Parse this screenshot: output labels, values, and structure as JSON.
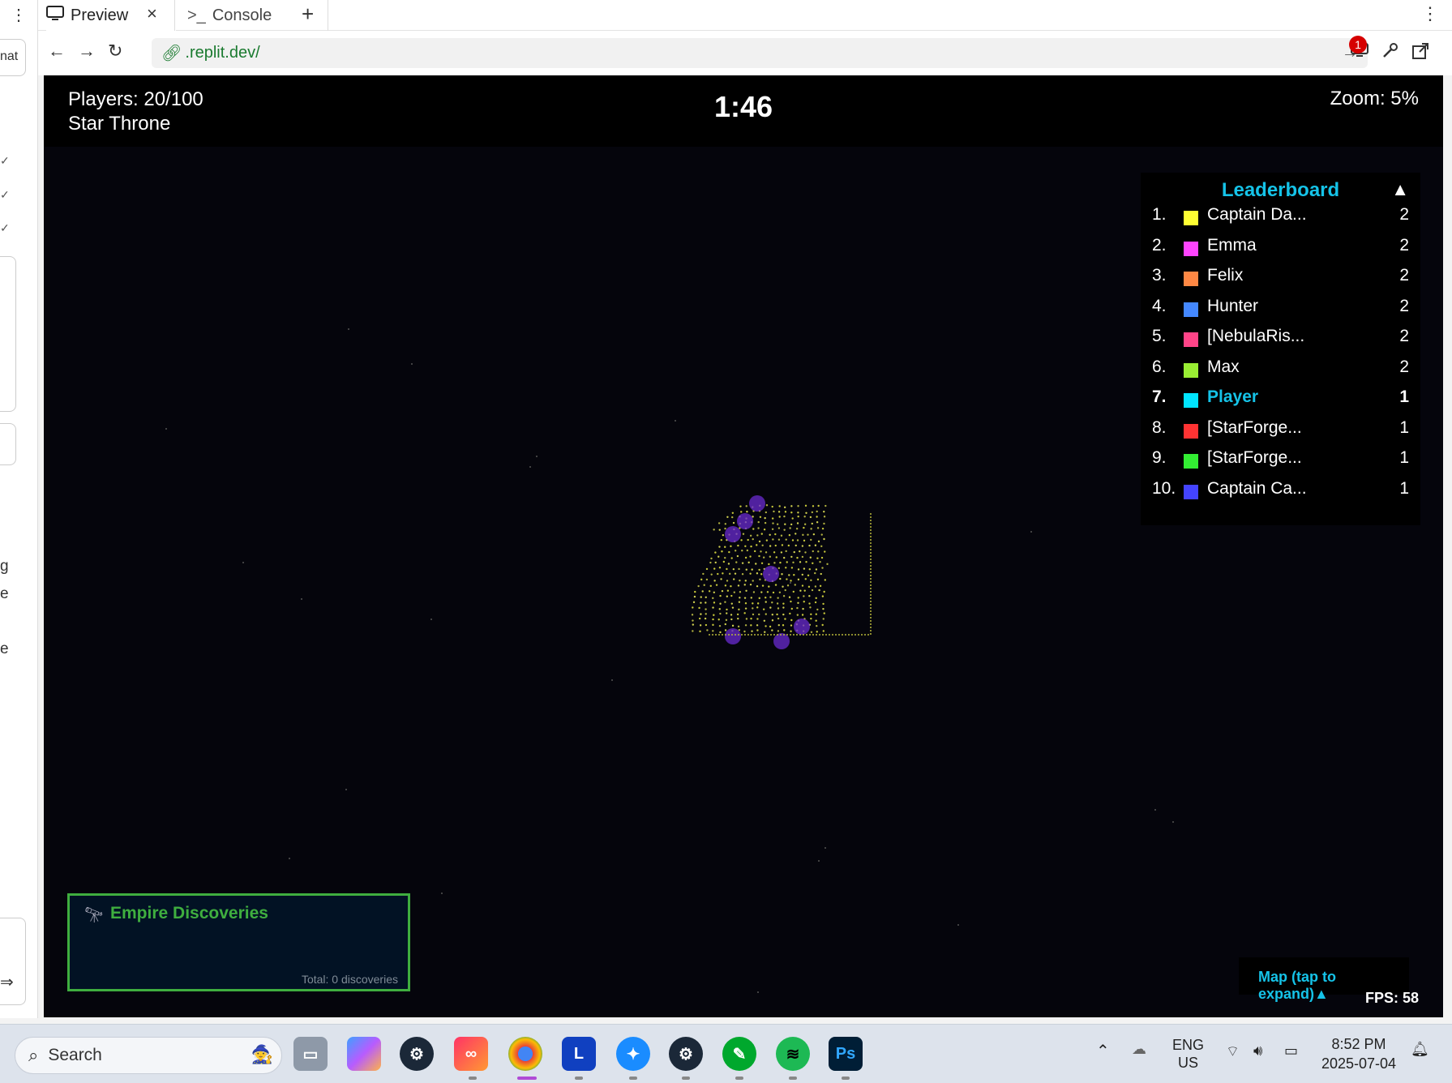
{
  "left_sidebar": {
    "fragment_top": "nat",
    "fragment_g": "g",
    "fragment_e1": "e",
    "fragment_e2": "e",
    "send_icon": "send-icon"
  },
  "browser": {
    "tabs": [
      {
        "label": "Preview",
        "icon": "monitor-icon"
      },
      {
        "label": "Console",
        "icon": "terminal-icon"
      }
    ],
    "url": ".replit.dev/",
    "notification_count": "1"
  },
  "game": {
    "players": "Players: 20/100",
    "title": "Star Throne",
    "timer": "1:46",
    "zoom": "Zoom: 5%",
    "leaderboard": {
      "title": "Leaderboard",
      "toggle": "▲",
      "rows": [
        {
          "rank": "1.",
          "name": "Captain Da...",
          "score": "2",
          "color": "#ffff33"
        },
        {
          "rank": "2.",
          "name": "Emma",
          "score": "2",
          "color": "#ff44ff"
        },
        {
          "rank": "3.",
          "name": "Felix",
          "score": "2",
          "color": "#ff8844"
        },
        {
          "rank": "4.",
          "name": "Hunter",
          "score": "2",
          "color": "#4488ff"
        },
        {
          "rank": "5.",
          "name": "[NebulaRis...",
          "score": "2",
          "color": "#ff4488"
        },
        {
          "rank": "6.",
          "name": "Max",
          "score": "2",
          "color": "#99ee33"
        },
        {
          "rank": "7.",
          "name": "Player",
          "score": "1",
          "color": "#00e5ff",
          "is_player": true
        },
        {
          "rank": "8.",
          "name": "[StarForge...",
          "score": "1",
          "color": "#ff3333"
        },
        {
          "rank": "9.",
          "name": "[StarForge...",
          "score": "1",
          "color": "#33ee33"
        },
        {
          "rank": "10.",
          "name": "Captain Ca...",
          "score": "1",
          "color": "#4444ff"
        }
      ]
    },
    "discoveries": {
      "title": "Empire Discoveries",
      "total": "Total: 0 discoveries"
    },
    "map_label": "Map (tap to expand)▲",
    "fps": "FPS: 58"
  },
  "taskbar": {
    "search_placeholder": "Search",
    "apps": [
      "task-view",
      "copilot",
      "steam",
      "creative-cloud",
      "chrome",
      "l-app",
      "bluestacks",
      "steam-2",
      "evernote",
      "spotify",
      "photoshop"
    ],
    "lang_top": "ENG",
    "lang_bottom": "US",
    "time": "8:52 PM",
    "date": "2025-07-04"
  }
}
